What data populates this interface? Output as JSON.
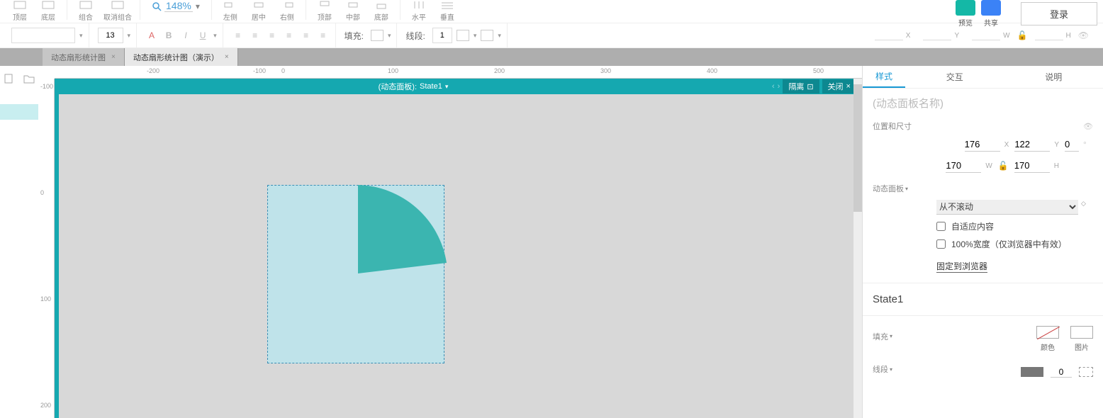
{
  "toolbar": {
    "top_layer": "顶层",
    "bottom_layer": "底层",
    "group": "组合",
    "ungroup": "取消组合",
    "zoom": "148%",
    "align_left": "左侧",
    "align_center": "居中",
    "align_right": "右侧",
    "align_top": "顶部",
    "align_middle": "中部",
    "align_bottom": "底部",
    "dist_h": "水平",
    "dist_v": "垂直",
    "preview": "预览",
    "share": "共享",
    "login": "登录"
  },
  "format": {
    "font_size": "13",
    "fill_label": "填充:",
    "line_label": "线段:",
    "line_width": "1",
    "x": "X",
    "y": "Y",
    "w": "W",
    "h": "H"
  },
  "tabs": [
    {
      "label": "动态扇形统计图",
      "active": false
    },
    {
      "label": "动态扇形统计图（演示）",
      "active": true
    }
  ],
  "ruler_h": [
    "-200",
    "-100",
    "0",
    "100",
    "200",
    "300",
    "400",
    "500"
  ],
  "ruler_v": [
    "-100",
    "0",
    "100",
    "200"
  ],
  "panel": {
    "title_prefix": "(动态面板):",
    "state": "State1",
    "isolate": "隔离",
    "close": "关闭"
  },
  "right": {
    "tabs": {
      "style": "样式",
      "interact": "交互",
      "note": "说明"
    },
    "name_placeholder": "(动态面板名称)",
    "pos_label": "位置和尺寸",
    "x": "176",
    "y": "122",
    "w": "170",
    "h": "170",
    "rot": "0",
    "xl": "X",
    "yl": "Y",
    "wl": "W",
    "hl": "H",
    "dp_label": "动态面板",
    "scroll_option": "从不滚动",
    "fit_content": "自适应内容",
    "full_width": "100%宽度（仅浏览器中有效）",
    "pin_browser": "固定到浏览器",
    "state_name": "State1",
    "fill_label": "填充",
    "fill_color": "颜色",
    "fill_image": "图片",
    "line_label": "线段",
    "line_width": "0"
  }
}
